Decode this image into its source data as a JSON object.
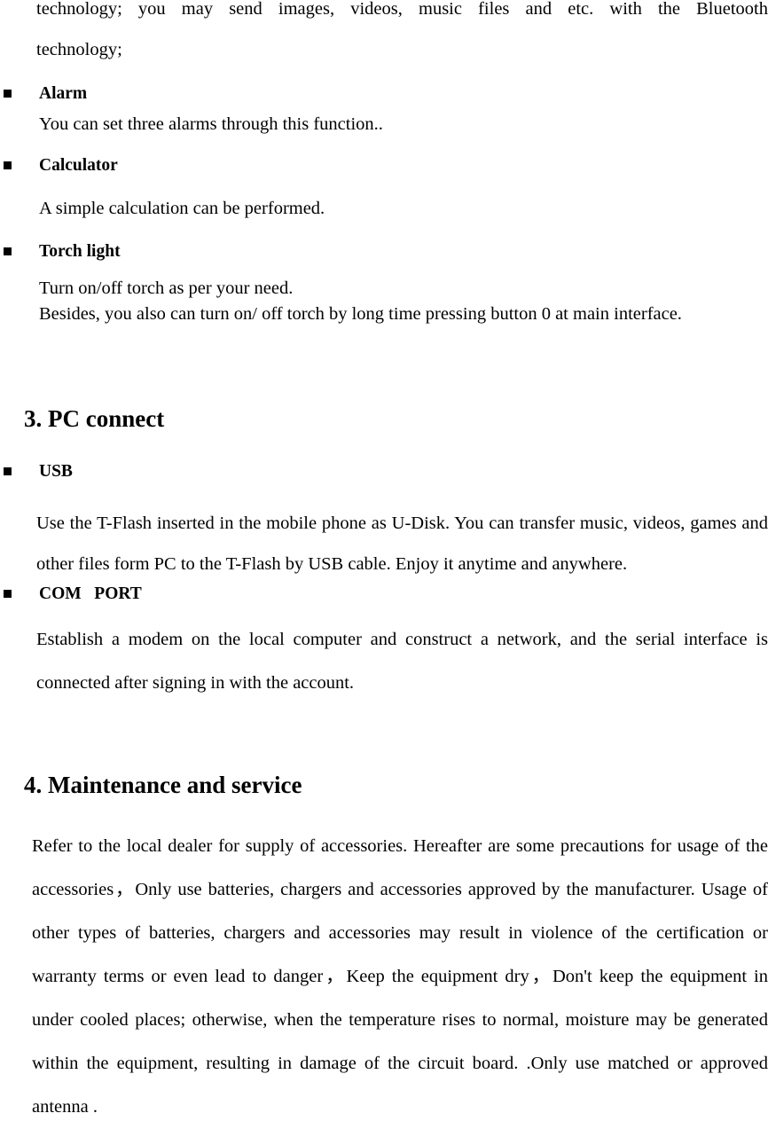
{
  "document": {
    "page_background": "#ffffff",
    "text_color": "#000000",
    "bullet_glyph": "filled-square"
  },
  "top_paragraph": {
    "line1": "technology; you may send images, videos, music files and etc. with the Bluetooth",
    "line2": "technology;"
  },
  "sections": [
    {
      "id": "alarm",
      "bullet_label": "Alarm",
      "body": [
        "You can set three alarms through this function.."
      ]
    },
    {
      "id": "calculator",
      "bullet_label": "Calculator",
      "body": [
        "A simple calculation can be performed."
      ]
    },
    {
      "id": "torch-light",
      "bullet_label": "Torch light",
      "body": [
        "Turn on/off torch as per your need.",
        "Besides, you also can turn on/ off torch by long time pressing button 0 at main interface."
      ]
    }
  ],
  "heading_pc_connect": {
    "number": "3.",
    "title": "PC connect"
  },
  "pc_sections": [
    {
      "id": "usb",
      "bullet_label": "USB",
      "body": "Use the T-Flash inserted in the mobile phone as U-Disk. You can transfer music, videos, games and other files form PC to the T-Flash by USB cable. Enjoy it anytime and anywhere."
    },
    {
      "id": "com-port",
      "bullet_label": "COM   PORT",
      "body": "Establish a modem on the local computer and construct a network, and the serial interface is connected after signing in with the account."
    }
  ],
  "heading_maintenance": {
    "number": "4.",
    "title": "Maintenance and service"
  },
  "maintenance_paragraph": "Refer to the local dealer for supply of accessories. Hereafter are some precautions for usage of the accessories，Only use batteries, chargers and accessories approved by the manufacturer. Usage of other types of batteries, chargers and accessories may result in violence of the certification or warranty terms or even lead to danger，Keep the equipment dry，Don't keep the equipment in under cooled places; otherwise, when the temperature rises to normal, moisture may be generated within the equipment, resulting in damage of the circuit board. .Only use matched or approved antenna ."
}
